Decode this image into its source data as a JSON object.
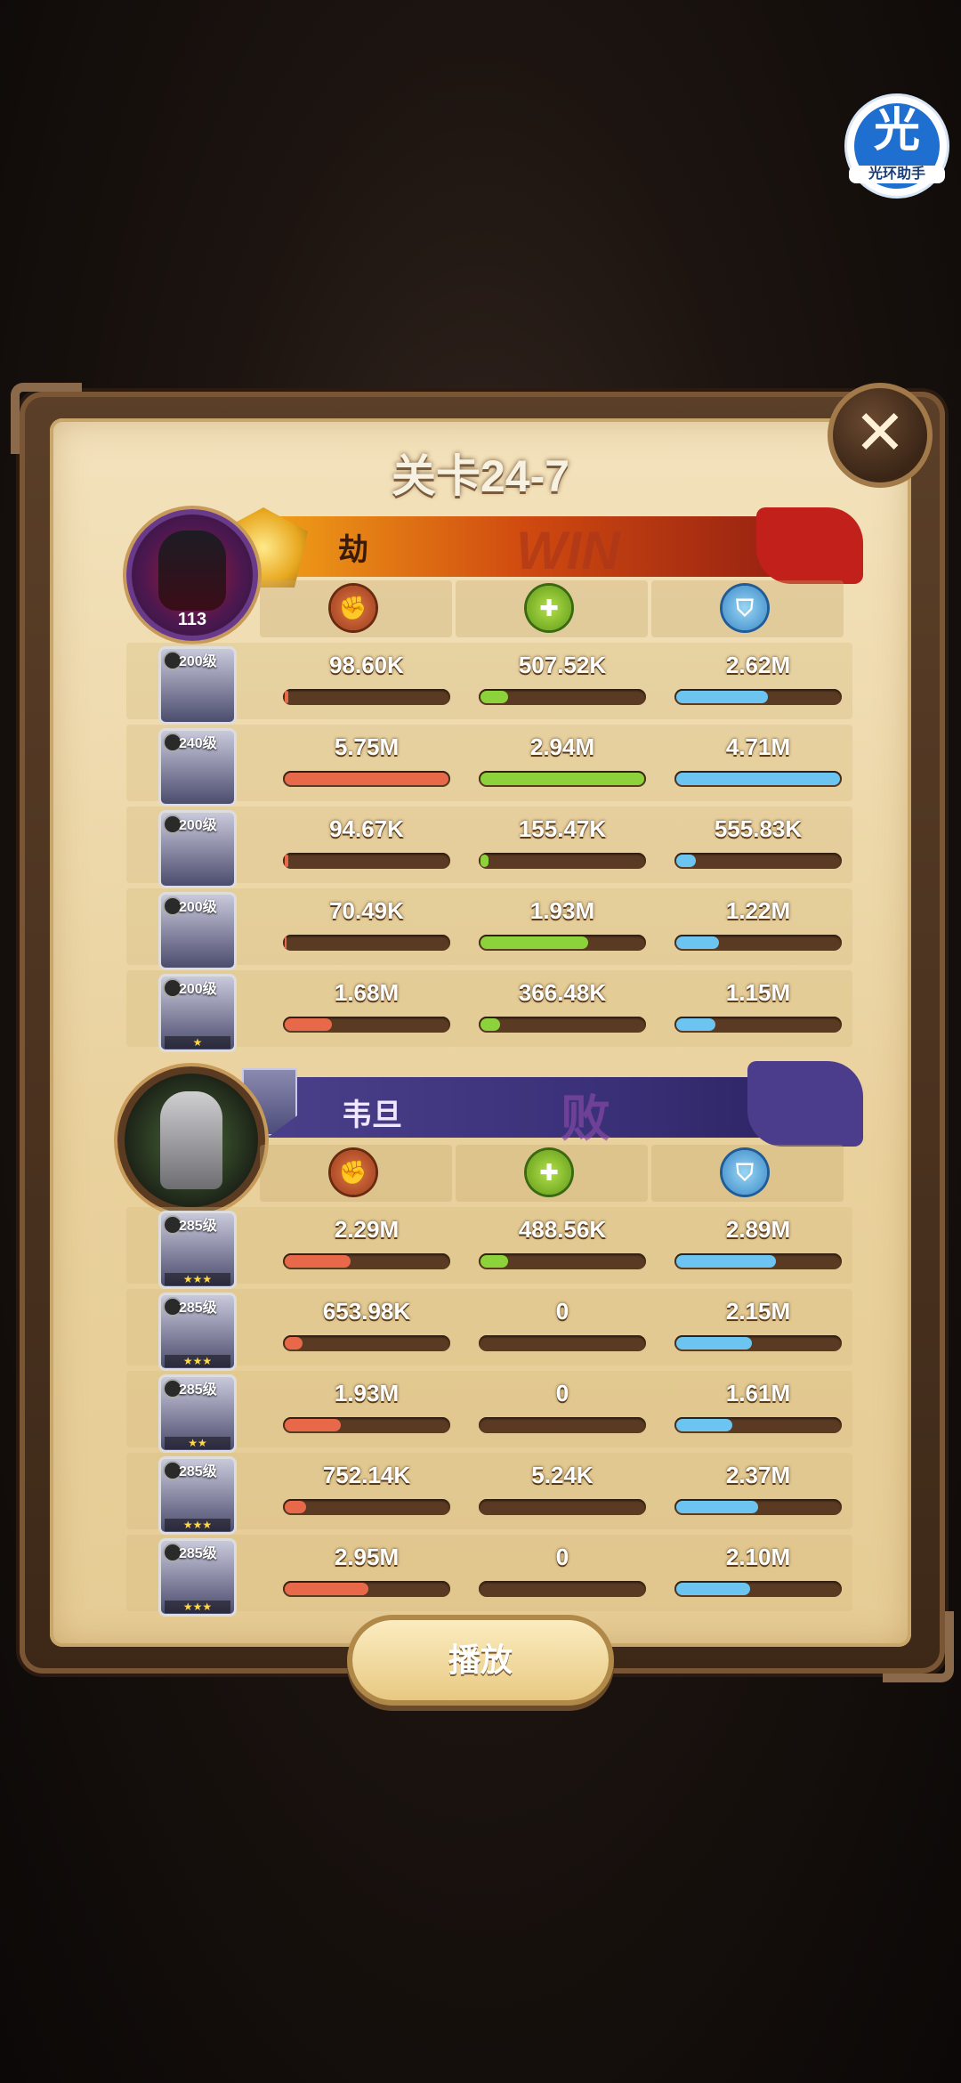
{
  "overlay_badge": {
    "glyph": "光",
    "text": "光环助手"
  },
  "title": "关卡24-7",
  "close_glyph": "✕",
  "play_label": "播放",
  "win_label": "WIN",
  "lose_label": "败",
  "icons": {
    "damage": "damage-icon",
    "heal": "heal-icon",
    "defense": "shield-icon"
  },
  "team1": {
    "player_name": "劫",
    "player_level": "113",
    "heroes": [
      {
        "level": "200级",
        "stars": "",
        "damage": "98.60K",
        "heal": "507.52K",
        "defense": "2.62M",
        "damage_frac": 0.02,
        "heal_frac": 0.17,
        "defense_frac": 0.56
      },
      {
        "level": "240级",
        "stars": "",
        "damage": "5.75M",
        "heal": "2.94M",
        "defense": "4.71M",
        "damage_frac": 1.0,
        "heal_frac": 1.0,
        "defense_frac": 1.0
      },
      {
        "level": "200级",
        "stars": "",
        "damage": "94.67K",
        "heal": "155.47K",
        "defense": "555.83K",
        "damage_frac": 0.02,
        "heal_frac": 0.05,
        "defense_frac": 0.12
      },
      {
        "level": "200级",
        "stars": "",
        "damage": "70.49K",
        "heal": "1.93M",
        "defense": "1.22M",
        "damage_frac": 0.01,
        "heal_frac": 0.66,
        "defense_frac": 0.26
      },
      {
        "level": "200级",
        "stars": "★",
        "damage": "1.68M",
        "heal": "366.48K",
        "defense": "1.15M",
        "damage_frac": 0.29,
        "heal_frac": 0.12,
        "defense_frac": 0.24
      }
    ]
  },
  "team2": {
    "player_name": "韦旦",
    "heroes": [
      {
        "level": "285级",
        "stars": "★★★",
        "damage": "2.29M",
        "heal": "488.56K",
        "defense": "2.89M",
        "damage_frac": 0.4,
        "heal_frac": 0.17,
        "defense_frac": 0.61
      },
      {
        "level": "285级",
        "stars": "★★★",
        "damage": "653.98K",
        "heal": "0",
        "defense": "2.15M",
        "damage_frac": 0.11,
        "heal_frac": 0.0,
        "defense_frac": 0.46
      },
      {
        "level": "285级",
        "stars": "★★",
        "damage": "1.93M",
        "heal": "0",
        "defense": "1.61M",
        "damage_frac": 0.34,
        "heal_frac": 0.0,
        "defense_frac": 0.34
      },
      {
        "level": "285级",
        "stars": "★★★",
        "damage": "752.14K",
        "heal": "5.24K",
        "defense": "2.37M",
        "damage_frac": 0.13,
        "heal_frac": 0.0,
        "defense_frac": 0.5
      },
      {
        "level": "285级",
        "stars": "★★★",
        "damage": "2.95M",
        "heal": "0",
        "defense": "2.10M",
        "damage_frac": 0.51,
        "heal_frac": 0.0,
        "defense_frac": 0.45
      }
    ]
  }
}
